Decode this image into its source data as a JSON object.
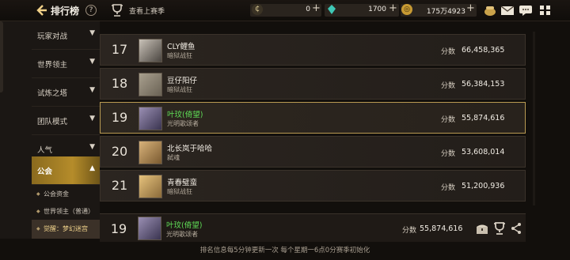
{
  "header": {
    "title": "排行榜",
    "prev_season": "查看上赛季",
    "currencies": [
      {
        "icon": "coupon-icon",
        "value": "0"
      },
      {
        "icon": "diamond-icon",
        "value": "1700"
      },
      {
        "icon": "gold-coin-icon",
        "value": "175万4923"
      }
    ]
  },
  "sidebar": {
    "items": [
      {
        "label": "玩家对战"
      },
      {
        "label": "世界领主"
      },
      {
        "label": "试炼之塔"
      },
      {
        "label": "团队模式"
      },
      {
        "label": "人气"
      },
      {
        "label": "公会"
      }
    ],
    "subitems": [
      {
        "label": "公会资金"
      },
      {
        "label": "世界领主（普通）"
      },
      {
        "label": "觉醒：梦幻迷宫"
      }
    ]
  },
  "rows": [
    {
      "rank": "17",
      "name": "CLY鲤鱼",
      "title": "暗狱战狂",
      "score_label": "分数",
      "score": "66,458,365"
    },
    {
      "rank": "18",
      "name": "豆仔阳仔",
      "title": "暗狱战狂",
      "score_label": "分数",
      "score": "56,384,153"
    },
    {
      "rank": "19",
      "name": "叶玟(倚望)",
      "title": "光明歌颂者",
      "score_label": "分数",
      "score": "55,874,616"
    },
    {
      "rank": "20",
      "name": "北长岚于哈哈",
      "title": "弑魂",
      "score_label": "分数",
      "score": "53,608,014"
    },
    {
      "rank": "21",
      "name": "青春璧蛮",
      "title": "暗狱战狂",
      "score_label": "分数",
      "score": "51,200,936"
    }
  ],
  "my_rank": {
    "rank": "19",
    "name": "叶玟(倚望)",
    "title": "光明歌颂者",
    "score_label": "分数",
    "score": "55,874,616"
  },
  "footer": "排名信息每5分钟更新一次 每个星期一6点0分赛季初始化",
  "colors": {
    "accent_gold": "#b99a52",
    "highlight_name": "#5fdc56",
    "active_tab": "#b58c2a"
  }
}
